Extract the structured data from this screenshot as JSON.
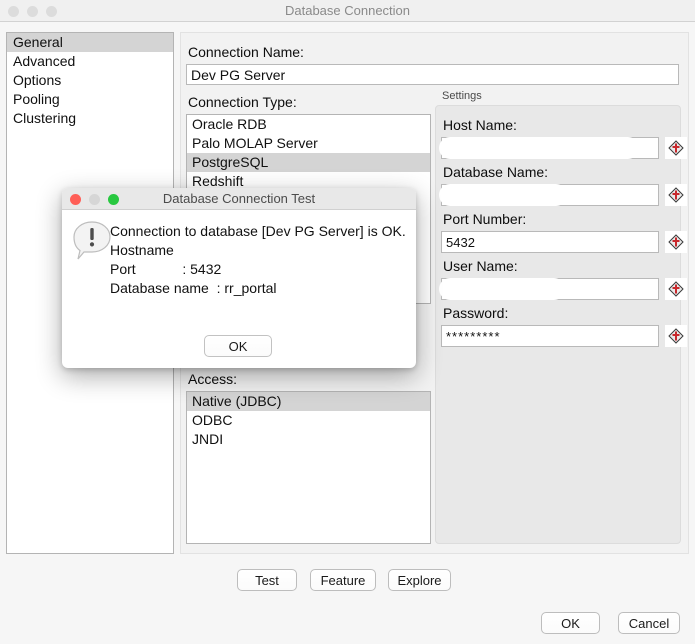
{
  "window": {
    "title": "Database Connection",
    "traffic_lights": [
      "window-close-dot",
      "window-minimize-dot",
      "window-zoom-dot"
    ]
  },
  "sidebar": {
    "items": [
      {
        "label": "General",
        "selected": true
      },
      {
        "label": "Advanced",
        "selected": false
      },
      {
        "label": "Options",
        "selected": false
      },
      {
        "label": "Pooling",
        "selected": false
      },
      {
        "label": "Clustering",
        "selected": false
      }
    ]
  },
  "main": {
    "connection_name": {
      "label": "Connection Name:",
      "value": "Dev PG Server",
      "placeholder": ""
    },
    "connection_type": {
      "label": "Connection Type:",
      "items": [
        {
          "label": "Oracle RDB",
          "selected": false
        },
        {
          "label": "Palo MOLAP Server",
          "selected": false
        },
        {
          "label": "PostgreSQL",
          "selected": true
        },
        {
          "label": "Redshift",
          "selected": false
        }
      ]
    },
    "access": {
      "label": "Access:",
      "items": [
        {
          "label": "Native (JDBC)",
          "selected": true
        },
        {
          "label": "ODBC",
          "selected": false
        },
        {
          "label": "JNDI",
          "selected": false
        }
      ]
    }
  },
  "settings": {
    "legend": "Settings",
    "fields": [
      {
        "label": "Host Name:",
        "value": "",
        "redacted": true,
        "icon": "red-diamond-icon"
      },
      {
        "label": "Database Name:",
        "value": "",
        "redacted": true,
        "icon": "red-diamond-icon"
      },
      {
        "label": "Port Number:",
        "value": "5432",
        "redacted": false,
        "icon": "red-diamond-icon"
      },
      {
        "label": "User Name:",
        "value": "",
        "redacted": true,
        "icon": "red-diamond-icon"
      },
      {
        "label": "Password:",
        "value": "*********",
        "redacted": false,
        "icon": "red-diamond-icon"
      }
    ]
  },
  "buttons": {
    "test": "Test",
    "feature": "Feature",
    "explore": "Explore",
    "ok": "OK",
    "cancel": "Cancel"
  },
  "dialog": {
    "title": "Database Connection Test",
    "message": "Connection to database [Dev PG Server] is OK.\nHostname\nPort            : 5432\nDatabase name  : rr_portal",
    "ok_label": "OK",
    "icon": "exclamation-bubble-icon"
  },
  "colors": {
    "selection": "#d4d4d4",
    "accent_red": "#c8282c",
    "traffic_red": "#ff5f57",
    "traffic_green": "#28c840",
    "traffic_gray": "#d6d6d6"
  }
}
